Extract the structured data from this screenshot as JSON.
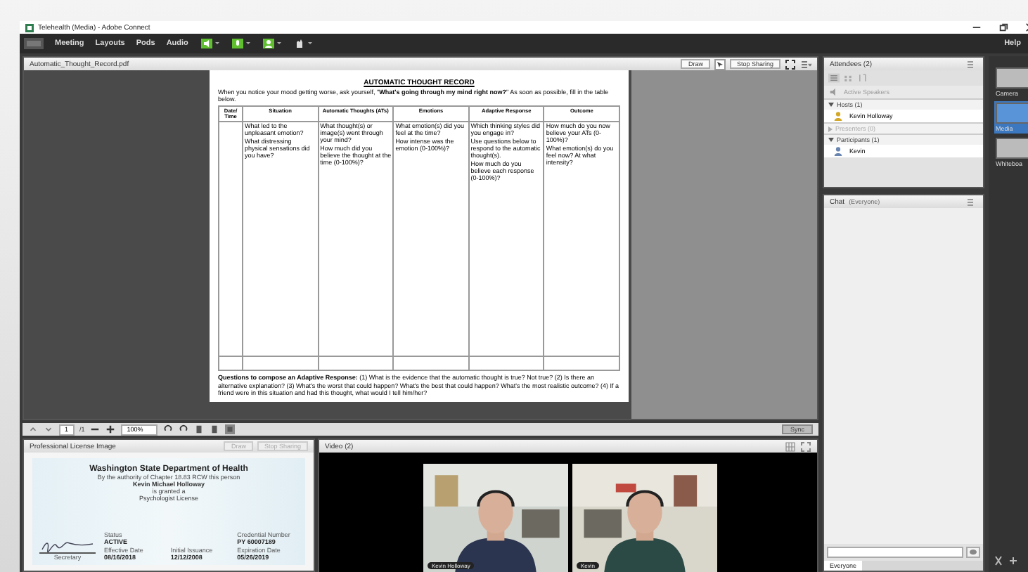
{
  "window": {
    "title": "Telehealth (Media) - Adobe Connect"
  },
  "menu": [
    "Meeting",
    "Layouts",
    "Pods",
    "Audio"
  ],
  "help": "Help",
  "share_pod": {
    "title": "Automatic_Thought_Record.pdf",
    "buttons": [
      "Draw",
      "Stop Sharing"
    ],
    "document": {
      "title": "AUTOMATIC THOUGHT RECORD",
      "intro": "When you notice your mood getting worse, ask yourself, \"**What's going through my mind right now?**\" As soon as possible, fill in the table below.",
      "columns": [
        "Date/ Time",
        "Situation",
        "Automatic Thoughts (ATs)",
        "Emotions",
        "Adaptive Response",
        "Outcome"
      ],
      "prompts": [
        [
          "What led to the unpleasant emotion?",
          "What distressing physical sensations did you have?"
        ],
        [
          "What thought(s) or image(s) went through your mind?",
          "How much did you believe the thought at the time (0-100%)?"
        ],
        [
          "What emotion(s) did you feel at the time?",
          "How intense was the emotion (0-100%)?"
        ],
        [
          "Which thinking styles did you engage in?",
          "Use questions below to respond to the automatic thought(s).",
          "How much do you believe each response (0-100%)?"
        ],
        [
          "How much do you now believe your ATs (0-100%)?",
          "What emotion(s) do you feel now? At what intensity?"
        ]
      ],
      "footer": "**Questions to compose an Adaptive Response:** (1) What is the evidence that the automatic thought is true? Not true? (2) Is there an alternative explanation? (3) What's the worst that could happen? What's the best that could happen? What's the most realistic outcome? (4) If a friend were in this situation and had this thought, what would I tell him/her?"
    },
    "toolbar": {
      "page": "1",
      "pages": "/1",
      "zoom": "100%",
      "sync": "Sync"
    }
  },
  "license_pod": {
    "title": "Professional License Image",
    "buttons": [
      "Draw",
      "Stop Sharing"
    ],
    "license": {
      "agency": "Washington State Department of Health",
      "authority": "By the authority of Chapter 18.83 RCW this person",
      "name": "Kevin Michael Holloway",
      "granted": "is granted a",
      "license": "Psychologist License",
      "fields": [
        {
          "label": "Status",
          "value": "ACTIVE"
        },
        {
          "label": "Credential Number",
          "value": "PY 60007189"
        },
        {
          "label": "Effective Date",
          "value": "08/16/2018"
        },
        {
          "label": "Initial Issuance",
          "value": "12/12/2008"
        },
        {
          "label": "Expiration Date",
          "value": "05/26/2019"
        }
      ],
      "signer": "Secretary"
    }
  },
  "video_pod": {
    "title": "Video (2)",
    "feeds": [
      {
        "name": "Kevin Holloway"
      },
      {
        "name": "Kevin"
      }
    ]
  },
  "attendees": {
    "title": "Attendees (2)",
    "active_speakers": "Active Speakers",
    "groups": [
      {
        "label": "Hosts (1)",
        "expanded": true,
        "people": [
          "Kevin Holloway"
        ]
      },
      {
        "label": "Presenters (0)",
        "expanded": false
      },
      {
        "label": "Participants (1)",
        "expanded": true,
        "people": [
          "Kevin"
        ]
      }
    ]
  },
  "chat": {
    "title": "Chat",
    "scope": "(Everyone)",
    "tabs": [
      {
        "label": "Everyone",
        "selected": true
      }
    ]
  },
  "layouts": [
    {
      "label": "Camera",
      "selected": false
    },
    {
      "label": "Media",
      "selected": true
    },
    {
      "label": "Whiteboa",
      "selected": false
    }
  ]
}
